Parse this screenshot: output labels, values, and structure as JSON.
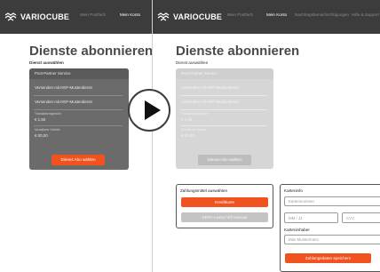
{
  "brand": {
    "logo_text": "VARIOCUBE"
  },
  "colors": {
    "accent": "#f0531f",
    "nav_bg": "#3c3c3c",
    "card_dark": "#6b6b6b"
  },
  "left": {
    "nav": [
      "Mein Postfach",
      "Mein Konto"
    ],
    "title": "Dienste abonnieren",
    "subtitle": "Dienst auswählen",
    "card": {
      "header": "Post-Partner Service",
      "line1": "Versenden mit KEP-Musterdienst",
      "line2": "Versenden mit KEP-Musterdienst",
      "fee_label": "Transaktionsgebühr",
      "fee_value": "€ 1,50",
      "monthly_label": "Monatliche Gebühr",
      "monthly_value": "€ 00,00",
      "button": "Dieses Abo wählen"
    }
  },
  "right": {
    "nav": [
      "Mein Postfach",
      "Mein Konto",
      "Nachtragsbenachrichtigungen",
      "Hilfe & Support"
    ],
    "title": "Dienste abonnieren",
    "subtitle": "Dienst auswählen",
    "card": {
      "header": "Post-Partner Service",
      "line1": "Versenden mit KEP-Musterdienst",
      "line2": "Versenden mit KEP-Musterdienst",
      "fee_label": "Transaktionsgebühr",
      "fee_value": "€ 1,50",
      "monthly_label": "Monatliche Gebühr",
      "monthly_value": "€ 00,00",
      "button": "Dieses Abo wählen"
    },
    "payment": {
      "label": "Zahlungsmittel auswählen",
      "option1": "Kreditkarte",
      "option2": "SEPA-Lastschrift Mandat"
    },
    "card_info": {
      "label": "Karteninfo",
      "number_placeholder": "Kartennummer",
      "expiry_placeholder": "MM / JJ",
      "cvv_placeholder": "CVV",
      "holder_label": "Karteninhaber",
      "holder_placeholder": "Max Mustermann",
      "save_button": "Zahlungsdaten speichern"
    }
  },
  "icons": {
    "play": "play-icon",
    "logo": "cube-logo-icon"
  }
}
